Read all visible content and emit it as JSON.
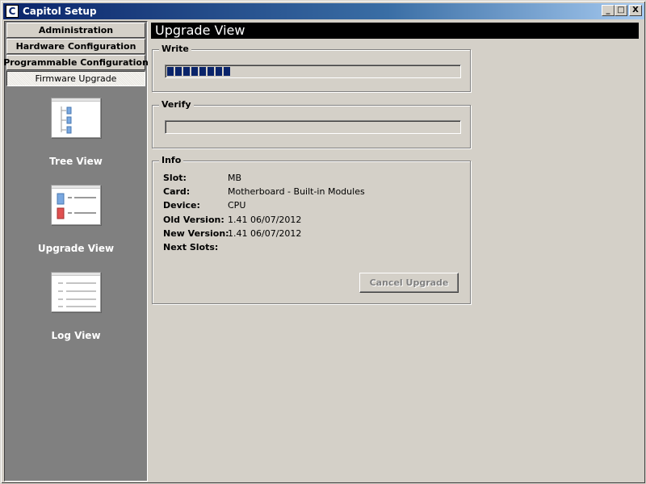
{
  "window": {
    "title": "Capitol Setup",
    "icon_letter": "C",
    "controls": {
      "minimize": "_",
      "maximize": "□",
      "close": "X"
    }
  },
  "sidebar": {
    "nav": [
      {
        "label": "Administration"
      },
      {
        "label": "Hardware Configuration"
      },
      {
        "label": "Programmable Configuration"
      },
      {
        "label": "Firmware Upgrade",
        "active": true
      }
    ],
    "views": [
      {
        "label": "Tree View",
        "icon": "tree-view-icon"
      },
      {
        "label": "Upgrade View",
        "icon": "upgrade-view-icon"
      },
      {
        "label": "Log View",
        "icon": "log-view-icon"
      }
    ]
  },
  "main": {
    "header": "Upgrade View",
    "write": {
      "title": "Write",
      "progress": 0.22
    },
    "verify": {
      "title": "Verify",
      "progress": 0
    },
    "info": {
      "title": "Info",
      "rows": [
        {
          "label": "Slot:",
          "value": "MB"
        },
        {
          "label": "Card:",
          "value": "Motherboard - Built-in Modules"
        },
        {
          "label": "Device:",
          "value": "CPU"
        },
        {
          "label": "Old Version:",
          "value": "1.41 06/07/2012"
        },
        {
          "label": "New Version:",
          "value": "1.41 06/07/2012"
        },
        {
          "label": "Next Slots:",
          "value": ""
        }
      ],
      "cancel_label": "Cancel Upgrade",
      "cancel_enabled": false
    }
  }
}
